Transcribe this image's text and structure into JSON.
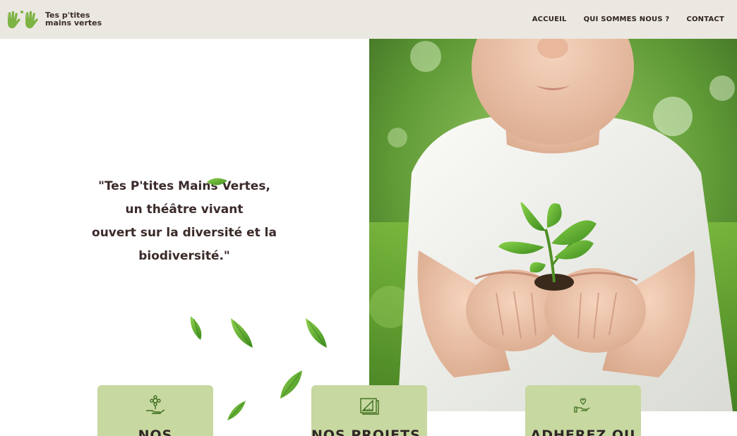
{
  "brand": {
    "line1": "Tes p'tites",
    "line2": "mains vertes",
    "colors": {
      "green": "#7cb342",
      "dark": "#3a2c2c"
    }
  },
  "nav": {
    "items": [
      {
        "label": "ACCUEIL"
      },
      {
        "label": "QUI SOMMES NOUS ?"
      },
      {
        "label": "CONTACT"
      }
    ]
  },
  "hero": {
    "quote_lines": [
      "\"Tes P'tites Mains Vertes,",
      "un théâtre vivant",
      "ouvert sur la diversité et la",
      "biodiversité.\""
    ],
    "photo_alt": "child-holding-seedling"
  },
  "cards": [
    {
      "title": "NOS",
      "icon": "hand-flower-icon"
    },
    {
      "title": "NOS PROJETS A",
      "icon": "blueprint-ruler-icon"
    },
    {
      "title": "ADHEREZ OU",
      "icon": "hand-heart-icon"
    }
  ],
  "colors": {
    "header_bg": "#ebe7e1",
    "card_bg": "#c7d8a0",
    "text": "#3b2a2a",
    "leaf": "#6fae2e"
  }
}
